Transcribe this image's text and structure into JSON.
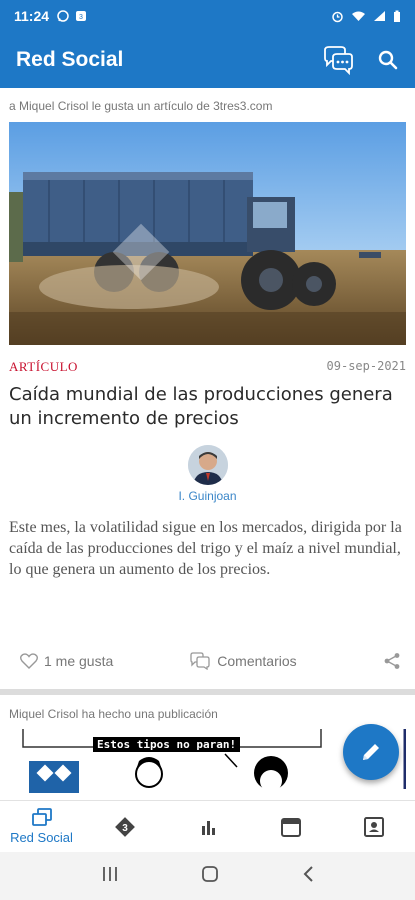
{
  "status_bar": {
    "time": "11:24",
    "left_icons": [
      "whatsapp-icon",
      "app-notification-icon"
    ],
    "right_icons": [
      "alarm-icon",
      "wifi-icon",
      "signal-icon",
      "battery-icon"
    ]
  },
  "app_bar": {
    "title": "Red Social",
    "actions": [
      "chat-icon",
      "search-icon"
    ]
  },
  "post1": {
    "activity": "a Miquel Crisol le gusta un artículo de 3tres3.com",
    "badge": "ARTÍCULO",
    "date": "09-sep-2021",
    "headline": "Caída mundial de las producciones genera un incremento de precios",
    "author": "I. Guinjoan",
    "excerpt": "Este mes, la volatilidad sigue en los mercados, dirigida por la caída de las producciones del trigo y el maíz a nivel mundial, lo que genera un aumento de los precios.",
    "likes": "1 me gusta",
    "comments": "Comentarios"
  },
  "post2": {
    "activity": "Miquel Crisol ha hecho una publicación",
    "comic_caption": "Estos tipos no paran!"
  },
  "bottom_nav": {
    "items": [
      {
        "label": "Red Social",
        "icon": "social-feed-icon",
        "active": true
      },
      {
        "label": "",
        "icon": "3tres3-logo-icon",
        "active": false
      },
      {
        "label": "",
        "icon": "bar-chart-icon",
        "active": false
      },
      {
        "label": "",
        "icon": "calendar-icon",
        "active": false
      },
      {
        "label": "",
        "icon": "contact-card-icon",
        "active": false
      }
    ]
  },
  "colors": {
    "primary": "#1e78c6",
    "badge": "#c8102e",
    "author_link": "#3a86c8"
  }
}
